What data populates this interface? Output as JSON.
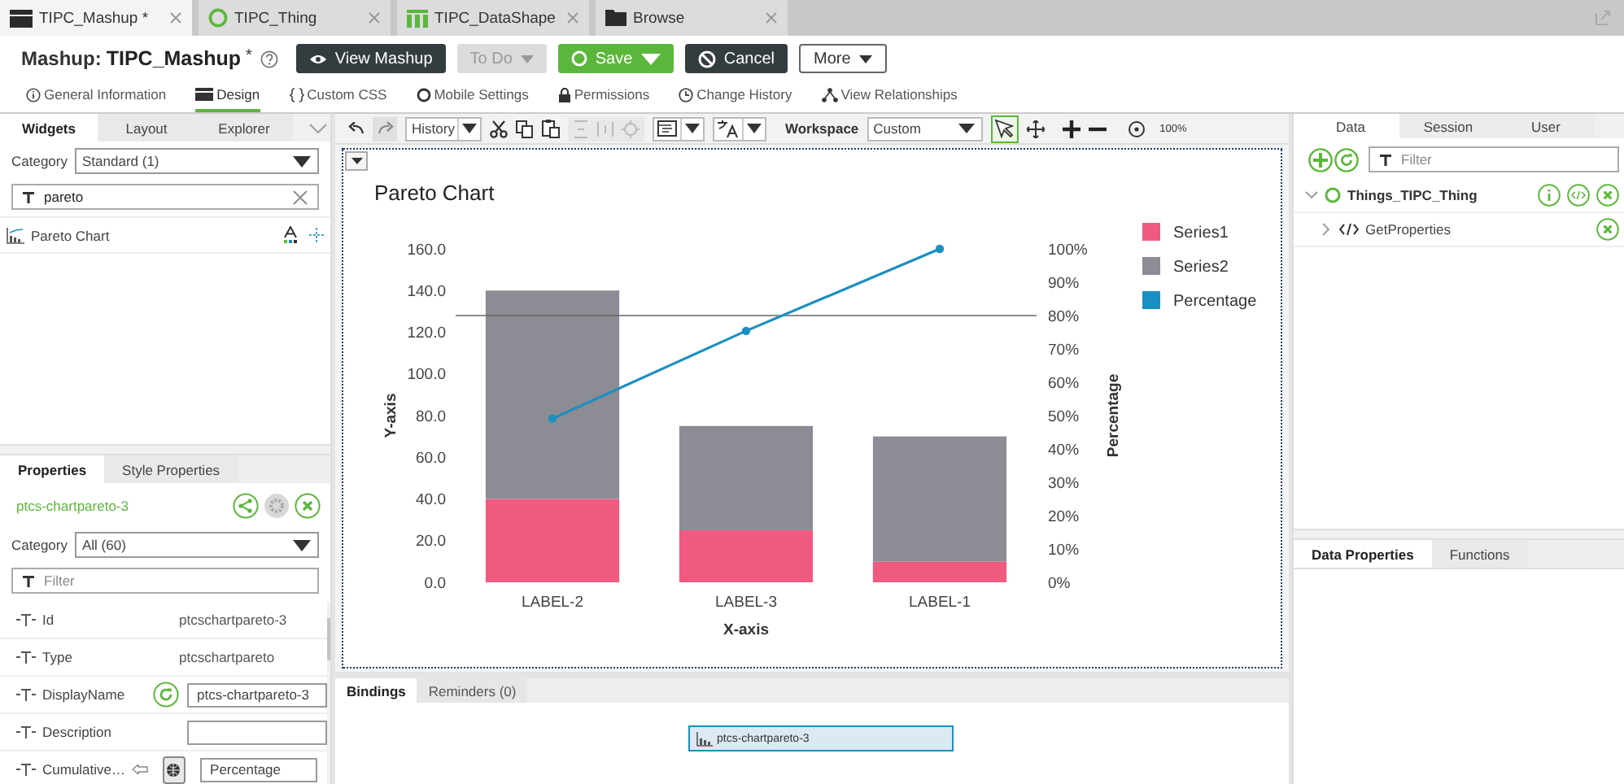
{
  "editor_tabs": [
    {
      "label": "TIPC_Mashup *",
      "kind": "mashup",
      "selected": true
    },
    {
      "label": "TIPC_Thing",
      "kind": "thing",
      "selected": false
    },
    {
      "label": "TIPC_DataShape",
      "kind": "datashape",
      "selected": false
    },
    {
      "label": "Browse",
      "kind": "folder",
      "selected": false
    }
  ],
  "header": {
    "prefix": "Mashup:",
    "name": "TIPC_Mashup",
    "modified_mark": "*",
    "buttons": [
      {
        "label": "View Mashup",
        "kind": "view",
        "disabled": false
      },
      {
        "label": "To Do",
        "kind": "todo",
        "disabled": true
      },
      {
        "label": "Save",
        "kind": "save",
        "disabled": false
      },
      {
        "label": "Cancel",
        "kind": "cancel",
        "disabled": false
      },
      {
        "label": "More",
        "kind": "more",
        "disabled": false
      }
    ]
  },
  "nav_tabs": [
    {
      "label": "General Information",
      "kind": "info",
      "selected": false
    },
    {
      "label": "Design",
      "kind": "design",
      "selected": true
    },
    {
      "label": "Custom CSS",
      "kind": "css",
      "selected": false
    },
    {
      "label": "Mobile Settings",
      "kind": "mobile",
      "selected": false
    },
    {
      "label": "Permissions",
      "kind": "lock",
      "selected": false
    },
    {
      "label": "Change History",
      "kind": "clock",
      "selected": false
    },
    {
      "label": "View Relationships",
      "kind": "tree",
      "selected": false
    }
  ],
  "widgets_panel": {
    "tabs": [
      {
        "label": "Widgets",
        "selected": true
      },
      {
        "label": "Layout",
        "selected": false
      },
      {
        "label": "Explorer",
        "selected": false
      }
    ],
    "category_label": "Category",
    "category": "Standard (1)",
    "search": "pareto",
    "items": [
      {
        "label": "Pareto Chart"
      }
    ]
  },
  "properties_panel": {
    "tabs": [
      {
        "label": "Properties",
        "selected": true
      },
      {
        "label": "Style Properties",
        "selected": false
      }
    ],
    "widget_id": "ptcs-chartpareto-3",
    "category_label": "Category",
    "category": "All (60)",
    "filter_placeholder": "Filter",
    "rows": [
      {
        "name": "Id",
        "kind": "text",
        "value": "ptcschartpareto-3"
      },
      {
        "name": "Type",
        "kind": "text",
        "value": "ptcschartpareto"
      },
      {
        "name": "DisplayName",
        "kind": "input_reset",
        "value": "ptcs-chartpareto-3"
      },
      {
        "name": "Description",
        "kind": "input"
      },
      {
        "name": "Cumulative…",
        "kind": "input_localized",
        "value": "Percentage"
      }
    ]
  },
  "toolbar": {
    "history": "History",
    "workspace_label": "Workspace",
    "workspace": "Custom",
    "zoom": "100%"
  },
  "canvas": {
    "chart_data": {
      "type": "bar",
      "stacked": true,
      "title": "Pareto Chart",
      "xlabel": "X-axis",
      "ylabel": "Y-axis",
      "y2label": "Percentage",
      "categories": [
        "LABEL-2",
        "LABEL-3",
        "LABEL-1"
      ],
      "series": [
        {
          "name": "Series1",
          "color": "#f05a80",
          "values": [
            40,
            25,
            10
          ]
        },
        {
          "name": "Series2",
          "color": "#8c8c94",
          "values": [
            100,
            50,
            60
          ]
        },
        {
          "name": "Percentage",
          "color": "#1b8fc1",
          "type": "line",
          "axis": "y2",
          "marker": "circle",
          "values": [
            49.1,
            75.4,
            100
          ]
        }
      ],
      "legend": "right",
      "ylim": [
        0,
        160
      ],
      "y2lim": [
        0,
        100
      ],
      "yticks": [
        {
          "value": 0,
          "label": "0.0"
        },
        {
          "value": 20,
          "label": "20.0"
        },
        {
          "value": 40,
          "label": "40.0"
        },
        {
          "value": 60,
          "label": "60.0"
        },
        {
          "value": 80,
          "label": "80.0"
        },
        {
          "value": 100,
          "label": "100.0"
        },
        {
          "value": 120,
          "label": "120.0"
        },
        {
          "value": 140,
          "label": "140.0"
        },
        {
          "value": 160,
          "label": "160.0"
        }
      ],
      "y2ticks": [
        {
          "value": 0,
          "label": "0%"
        },
        {
          "value": 10,
          "label": "10%"
        },
        {
          "value": 20,
          "label": "20%"
        },
        {
          "value": 30,
          "label": "30%"
        },
        {
          "value": 40,
          "label": "40%"
        },
        {
          "value": 50,
          "label": "50%"
        },
        {
          "value": 60,
          "label": "60%"
        },
        {
          "value": 70,
          "label": "70%"
        },
        {
          "value": 80,
          "label": "80%"
        },
        {
          "value": 90,
          "label": "90%"
        },
        {
          "value": 100,
          "label": "100%"
        }
      ],
      "ref_lines": [
        {
          "axis": "y2",
          "value": 80
        }
      ]
    }
  },
  "bindings_panel": {
    "tabs": [
      {
        "label": "Bindings",
        "selected": true
      },
      {
        "label": "Reminders (0)",
        "selected": false
      }
    ],
    "node": "ptcs-chartpareto-3"
  },
  "data_panel": {
    "tabs": [
      {
        "label": "Data",
        "selected": true
      },
      {
        "label": "Session",
        "selected": false
      },
      {
        "label": "User",
        "selected": false
      }
    ],
    "filter_placeholder": "Filter",
    "tree": [
      {
        "label": "Things_TIPC_Thing",
        "expanded": true,
        "children": [
          {
            "label": "GetProperties",
            "expanded": false
          }
        ]
      }
    ],
    "bottom_tabs": [
      {
        "label": "Data Properties",
        "selected": true
      },
      {
        "label": "Functions",
        "selected": false
      }
    ]
  }
}
